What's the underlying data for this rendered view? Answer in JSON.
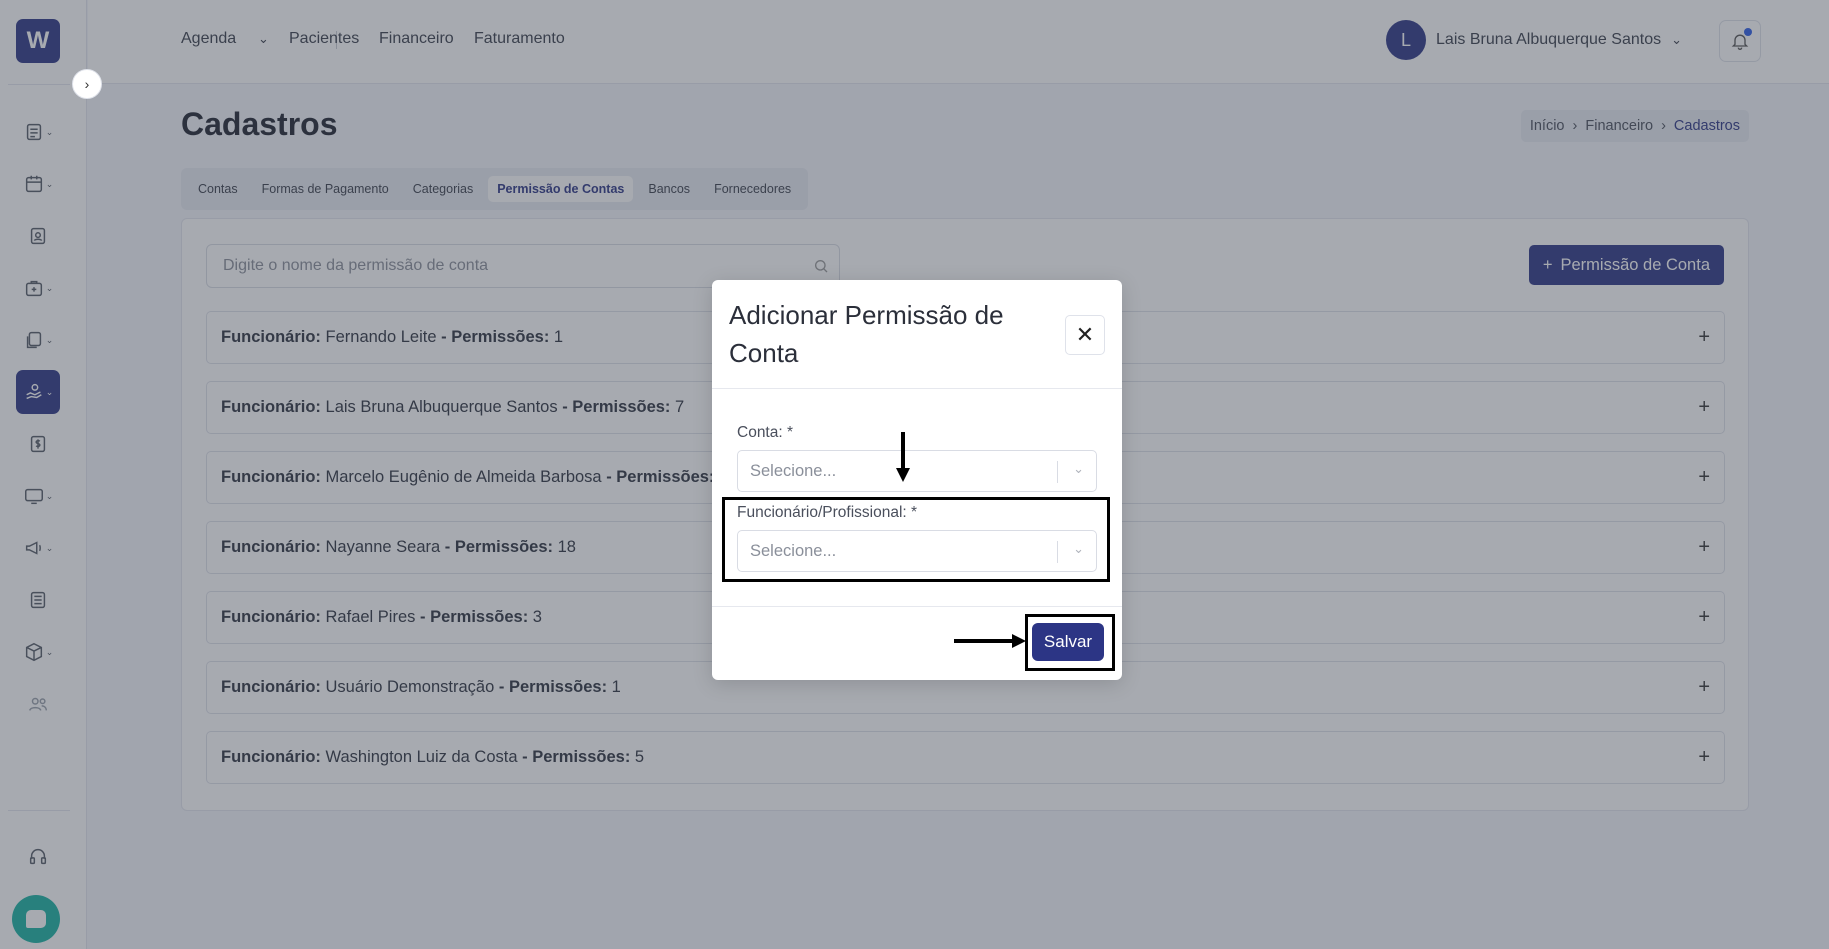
{
  "app": {
    "logo_letter": "W"
  },
  "topnav": {
    "items": [
      "Agenda",
      "Pacientes",
      "Financeiro",
      "Faturamento"
    ],
    "user_initial": "L",
    "user_name": "Lais Bruna Albuquerque Santos"
  },
  "header": {
    "title": "Cadastros",
    "breadcrumb": [
      "Início",
      "Financeiro",
      "Cadastros"
    ]
  },
  "tabs": [
    "Contas",
    "Formas de Pagamento",
    "Categorias",
    "Permissão de Contas",
    "Bancos",
    "Fornecedores"
  ],
  "active_tab": "Permissão de Contas",
  "search": {
    "placeholder": "Digite o nome da permissão de conta"
  },
  "add_button": "Permissão de Conta",
  "list": {
    "employee_label": "Funcionário:",
    "permissions_label": "- Permissões:",
    "rows": [
      {
        "name": "Fernando Leite",
        "count": "1"
      },
      {
        "name": "Lais Bruna Albuquerque Santos",
        "count": "7"
      },
      {
        "name": "Marcelo Eugênio de Almeida Barbosa",
        "count": ""
      },
      {
        "name": "Nayanne Seara",
        "count": "18"
      },
      {
        "name": "Rafael Pires",
        "count": "3"
      },
      {
        "name": "Usuário Demonstração",
        "count": "1"
      },
      {
        "name": "Washington Luiz da Costa",
        "count": "5"
      }
    ]
  },
  "modal": {
    "title": "Adicionar Permissão de Conta",
    "conta_label": "Conta: *",
    "conta_placeholder": "Selecione...",
    "funcionario_label": "Funcionário/Profissional: *",
    "funcionario_placeholder": "Selecione...",
    "save_label": "Salvar"
  },
  "colors": {
    "primary": "#2c3585",
    "chat": "#19b3a3"
  }
}
